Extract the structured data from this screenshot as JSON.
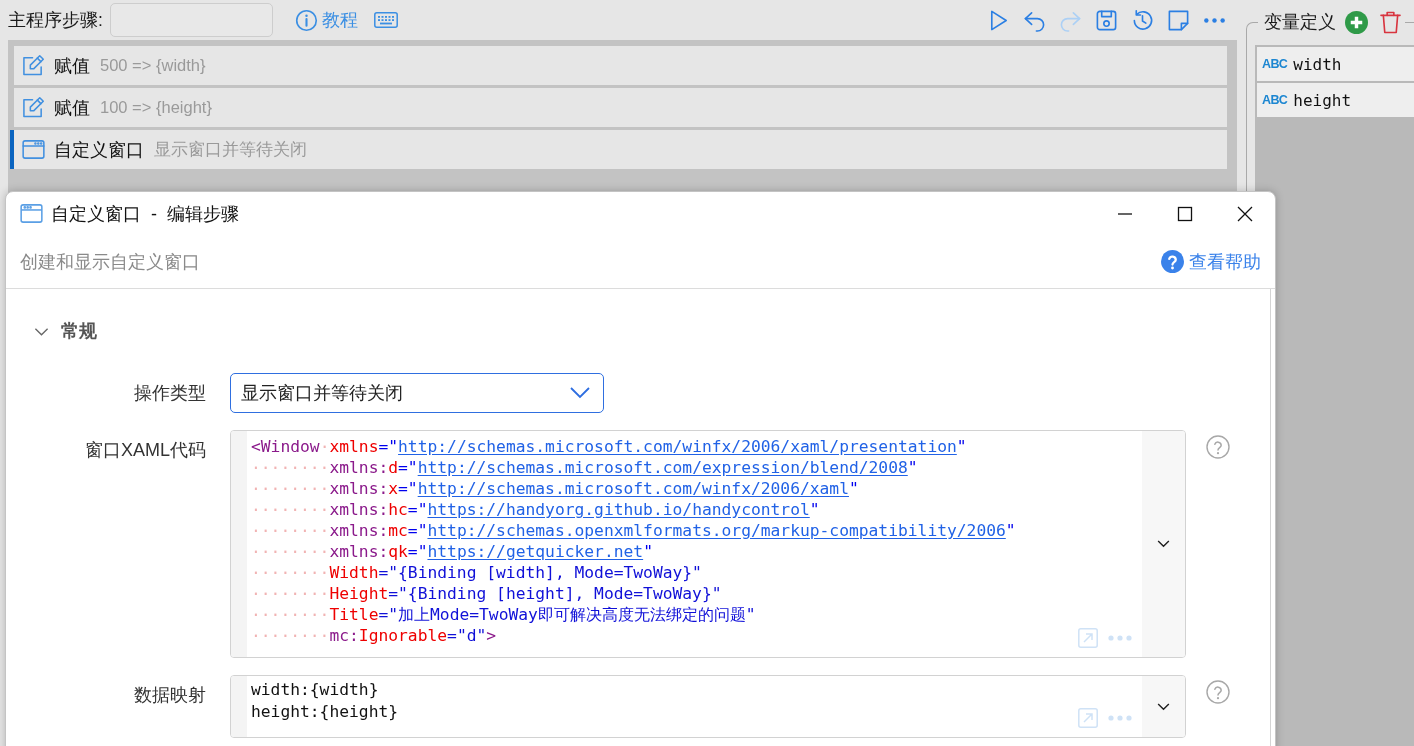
{
  "toolbar": {
    "label": "主程序步骤:",
    "tutorial_link": "教程"
  },
  "actions": [
    {
      "kind": "run",
      "disabled": false
    },
    {
      "kind": "undo",
      "disabled": false
    },
    {
      "kind": "redo",
      "disabled": true
    },
    {
      "kind": "save",
      "disabled": false
    },
    {
      "kind": "history",
      "disabled": false
    },
    {
      "kind": "note",
      "disabled": false
    },
    {
      "kind": "more",
      "disabled": false
    }
  ],
  "steps": [
    {
      "kind": "assign",
      "name": "赋值",
      "summary": "500 => {width}",
      "selected": false
    },
    {
      "kind": "assign",
      "name": "赋值",
      "summary": "100 => {height}",
      "selected": false
    },
    {
      "kind": "window",
      "name": "自定义窗口",
      "summary": "显示窗口并等待关闭",
      "selected": true
    }
  ],
  "variables": {
    "title": "变量定义",
    "items": [
      {
        "type": "ABC",
        "name": "width"
      },
      {
        "type": "ABC",
        "name": "height"
      }
    ]
  },
  "dialog": {
    "title": "自定义窗口 - 编辑步骤",
    "description": "创建和显示自定义窗口",
    "help_link": "查看帮助",
    "section": {
      "title": "常规",
      "expanded": true
    },
    "fields": [
      {
        "kind": "select",
        "label": "操作类型",
        "value": "显示窗口并等待关闭",
        "help": false
      },
      {
        "kind": "code",
        "label": "窗口XAML代码",
        "help": true,
        "lines": [
          [
            {
              "text": "<Window",
              "kind": "tag"
            },
            {
              "text": "·",
              "kind": "space"
            },
            {
              "text": "xmlns",
              "kind": "attr"
            },
            {
              "text": "=\"",
              "kind": "punct"
            },
            {
              "text": "http://schemas.microsoft.com/winfx/2006/xaml/presentation",
              "kind": "link"
            },
            {
              "text": "\"",
              "kind": "punct"
            }
          ],
          [
            {
              "text": "········",
              "kind": "space"
            },
            {
              "text": "xmlns:",
              "kind": "tag"
            },
            {
              "text": "d",
              "kind": "attr"
            },
            {
              "text": "=\"",
              "kind": "punct"
            },
            {
              "text": "http://schemas.microsoft.com/expression/blend/2008",
              "kind": "link"
            },
            {
              "text": "\"",
              "kind": "punct"
            }
          ],
          [
            {
              "text": "········",
              "kind": "space"
            },
            {
              "text": "xmlns:",
              "kind": "tag"
            },
            {
              "text": "x",
              "kind": "attr"
            },
            {
              "text": "=\"",
              "kind": "punct"
            },
            {
              "text": "http://schemas.microsoft.com/winfx/2006/xaml",
              "kind": "link"
            },
            {
              "text": "\"",
              "kind": "punct"
            }
          ],
          [
            {
              "text": "········",
              "kind": "space"
            },
            {
              "text": "xmlns:",
              "kind": "tag"
            },
            {
              "text": "hc",
              "kind": "attr"
            },
            {
              "text": "=\"",
              "kind": "punct"
            },
            {
              "text": "https://handyorg.github.io/handycontrol",
              "kind": "link"
            },
            {
              "text": "\"",
              "kind": "punct"
            }
          ],
          [
            {
              "text": "········",
              "kind": "space"
            },
            {
              "text": "xmlns:",
              "kind": "tag"
            },
            {
              "text": "mc",
              "kind": "attr"
            },
            {
              "text": "=\"",
              "kind": "punct"
            },
            {
              "text": "http://schemas.openxmlformats.org/markup-compatibility/2006",
              "kind": "link"
            },
            {
              "text": "\"",
              "kind": "punct"
            }
          ],
          [
            {
              "text": "········",
              "kind": "space"
            },
            {
              "text": "xmlns:",
              "kind": "tag"
            },
            {
              "text": "qk",
              "kind": "attr"
            },
            {
              "text": "=\"",
              "kind": "punct"
            },
            {
              "text": "https://getquicker.net",
              "kind": "link"
            },
            {
              "text": "\"",
              "kind": "punct"
            }
          ],
          [
            {
              "text": "········",
              "kind": "space"
            },
            {
              "text": "Width",
              "kind": "attr"
            },
            {
              "text": "=\"{Binding [width], Mode=TwoWay}\"",
              "kind": "string"
            }
          ],
          [
            {
              "text": "········",
              "kind": "space"
            },
            {
              "text": "Height",
              "kind": "attr"
            },
            {
              "text": "=\"{Binding [height], Mode=TwoWay}\"",
              "kind": "string"
            }
          ],
          [
            {
              "text": "········",
              "kind": "space"
            },
            {
              "text": "Title",
              "kind": "attr"
            },
            {
              "text": "=\"加上Mode=TwoWay即可解决高度无法绑定的问题\"",
              "kind": "string"
            }
          ],
          [
            {
              "text": "········",
              "kind": "space"
            },
            {
              "text": "mc:",
              "kind": "tag"
            },
            {
              "text": "Ignorable",
              "kind": "attr"
            },
            {
              "text": "=\"d\"",
              "kind": "string"
            },
            {
              "text": ">",
              "kind": "tag"
            }
          ]
        ]
      },
      {
        "kind": "text",
        "label": "数据映射",
        "help": true,
        "lines": [
          "width:{width}",
          "height:{height}"
        ]
      }
    ]
  }
}
